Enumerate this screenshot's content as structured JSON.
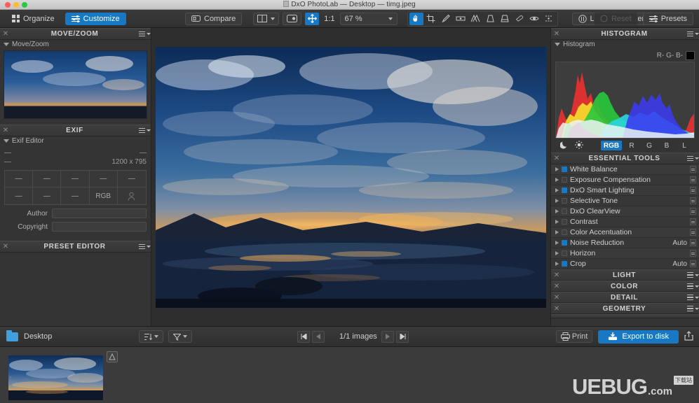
{
  "window": {
    "title": "DxO PhotoLab — Desktop — timg.jpeg",
    "doc_icon": "document-icon"
  },
  "toolbar": {
    "organize_label": "Organize",
    "organize_icon": "grid-icon",
    "customize_label": "Customize",
    "customize_icon": "sliders-icon",
    "compare_label": "Compare",
    "compare_icon": "compare-icon",
    "view_mode_icon": "split-view-icon",
    "view_mode_caret": "chevron-down-icon",
    "preview_icon": "preview-icon",
    "hand_icon": "move-hand-icon",
    "ratio_label": "1:1",
    "zoom_value": "67 %",
    "zoom_caret": "chevron-down-icon",
    "tools": [
      {
        "name": "hand-tool-icon",
        "selected": true
      },
      {
        "name": "crop-tool-icon",
        "selected": false
      },
      {
        "name": "retouch-brush-icon",
        "selected": false
      },
      {
        "name": "horizon-tool-icon",
        "selected": false
      },
      {
        "name": "perspective-tool-icon",
        "selected": false
      },
      {
        "name": "keystone-tool-icon",
        "selected": false
      },
      {
        "name": "force-parallel-icon",
        "selected": false
      },
      {
        "name": "red-eye-icon",
        "selected": false
      },
      {
        "name": "eye-preview-icon",
        "selected": false
      },
      {
        "name": "equalizer-icon",
        "selected": false
      }
    ],
    "local_adjustments_label": "Local adjustments",
    "local_adjustments_icon": "local-adjust-icon",
    "reset_label": "Reset",
    "reset_icon": "reset-circle-icon",
    "reset_disabled": true,
    "presets_label": "Presets",
    "presets_icon": "presets-sliders-icon"
  },
  "left_panels": {
    "move_zoom": {
      "title": "MOVE/ZOOM",
      "sub_title": "Move/Zoom",
      "close_icon": "close-icon",
      "menu_icon": "panel-menu-icon",
      "disclosure_icon": "triangle-down-icon"
    },
    "exif": {
      "title": "EXIF",
      "sub_title": "Exif Editor",
      "close_icon": "close-icon",
      "menu_icon": "panel-menu-icon",
      "left_value_top": "—",
      "right_value_top": "—",
      "left_value_bottom": "—",
      "dimensions": "1200 x 795",
      "cells_row1": [
        "—",
        "—",
        "—",
        "—",
        "—"
      ],
      "cells_row2": [
        "—",
        "—",
        "—",
        "RGB",
        "person-icon"
      ],
      "author_label": "Author",
      "author_value": "",
      "copyright_label": "Copyright",
      "copyright_value": ""
    },
    "preset_editor": {
      "title": "PRESET EDITOR",
      "close_icon": "close-icon",
      "menu_icon": "panel-menu-icon"
    }
  },
  "right_panels": {
    "histogram": {
      "title": "HISTOGRAM",
      "sub_title": "Histogram",
      "close_icon": "close-icon",
      "menu_icon": "panel-menu-icon",
      "readout": "R- G- B-",
      "swatch_color": "#000000",
      "shadow_icon": "moon-icon",
      "highlight_icon": "sun-icon",
      "channels": [
        {
          "label": "RGB",
          "active": true
        },
        {
          "label": "R",
          "active": false
        },
        {
          "label": "G",
          "active": false
        },
        {
          "label": "B",
          "active": false
        },
        {
          "label": "L",
          "active": false
        }
      ]
    },
    "essential_tools": {
      "title": "ESSENTIAL TOOLS",
      "close_icon": "close-icon",
      "menu_icon": "panel-menu-icon",
      "items": [
        {
          "label": "White Balance",
          "enabled": true,
          "auto": ""
        },
        {
          "label": "Exposure Compensation",
          "enabled": false,
          "auto": ""
        },
        {
          "label": "DxO Smart Lighting",
          "enabled": true,
          "auto": ""
        },
        {
          "label": "Selective Tone",
          "enabled": false,
          "auto": ""
        },
        {
          "label": "DxO ClearView",
          "enabled": false,
          "auto": ""
        },
        {
          "label": "Contrast",
          "enabled": false,
          "auto": ""
        },
        {
          "label": "Color Accentuation",
          "enabled": false,
          "auto": ""
        },
        {
          "label": "Noise Reduction",
          "enabled": true,
          "auto": "Auto"
        },
        {
          "label": "Horizon",
          "enabled": false,
          "auto": ""
        },
        {
          "label": "Crop",
          "enabled": true,
          "auto": "Auto"
        }
      ]
    },
    "groups": [
      {
        "title": "LIGHT",
        "close_icon": "close-icon",
        "menu_icon": "panel-menu-icon"
      },
      {
        "title": "COLOR",
        "close_icon": "close-icon",
        "menu_icon": "panel-menu-icon"
      },
      {
        "title": "DETAIL",
        "close_icon": "close-icon",
        "menu_icon": "panel-menu-icon"
      },
      {
        "title": "GEOMETRY",
        "close_icon": "close-icon",
        "menu_icon": "panel-menu-icon"
      }
    ]
  },
  "bottom_bar": {
    "folder_icon": "folder-icon",
    "folder_name": "Desktop",
    "sort_icon": "sort-icon",
    "sort_caret": "chevron-down-icon",
    "filter_icon": "filter-icon",
    "filter_caret": "chevron-down-icon",
    "nav_first_icon": "skip-first-icon",
    "nav_prev_icon": "previous-icon",
    "image_count": "1/1 images",
    "nav_next_icon": "next-icon",
    "nav_last_icon": "skip-last-icon",
    "print_label": "Print",
    "print_icon": "printer-icon",
    "export_label": "Export to disk",
    "export_icon": "export-disk-icon",
    "share_icon": "share-icon"
  },
  "filmstrip": {
    "thumbnail_name": "image-thumbnail",
    "badge_icon": "virtual-copy-icon",
    "rating_dots_icon": "rating-dots-icon"
  },
  "watermark": {
    "brand": "UEBUG",
    "tld": ".com",
    "badge": "下载站"
  },
  "colors": {
    "accent": "#1878c4",
    "panel_bg": "#343434",
    "toolbar_bg": "#353535",
    "text": "#c8c8c8"
  }
}
